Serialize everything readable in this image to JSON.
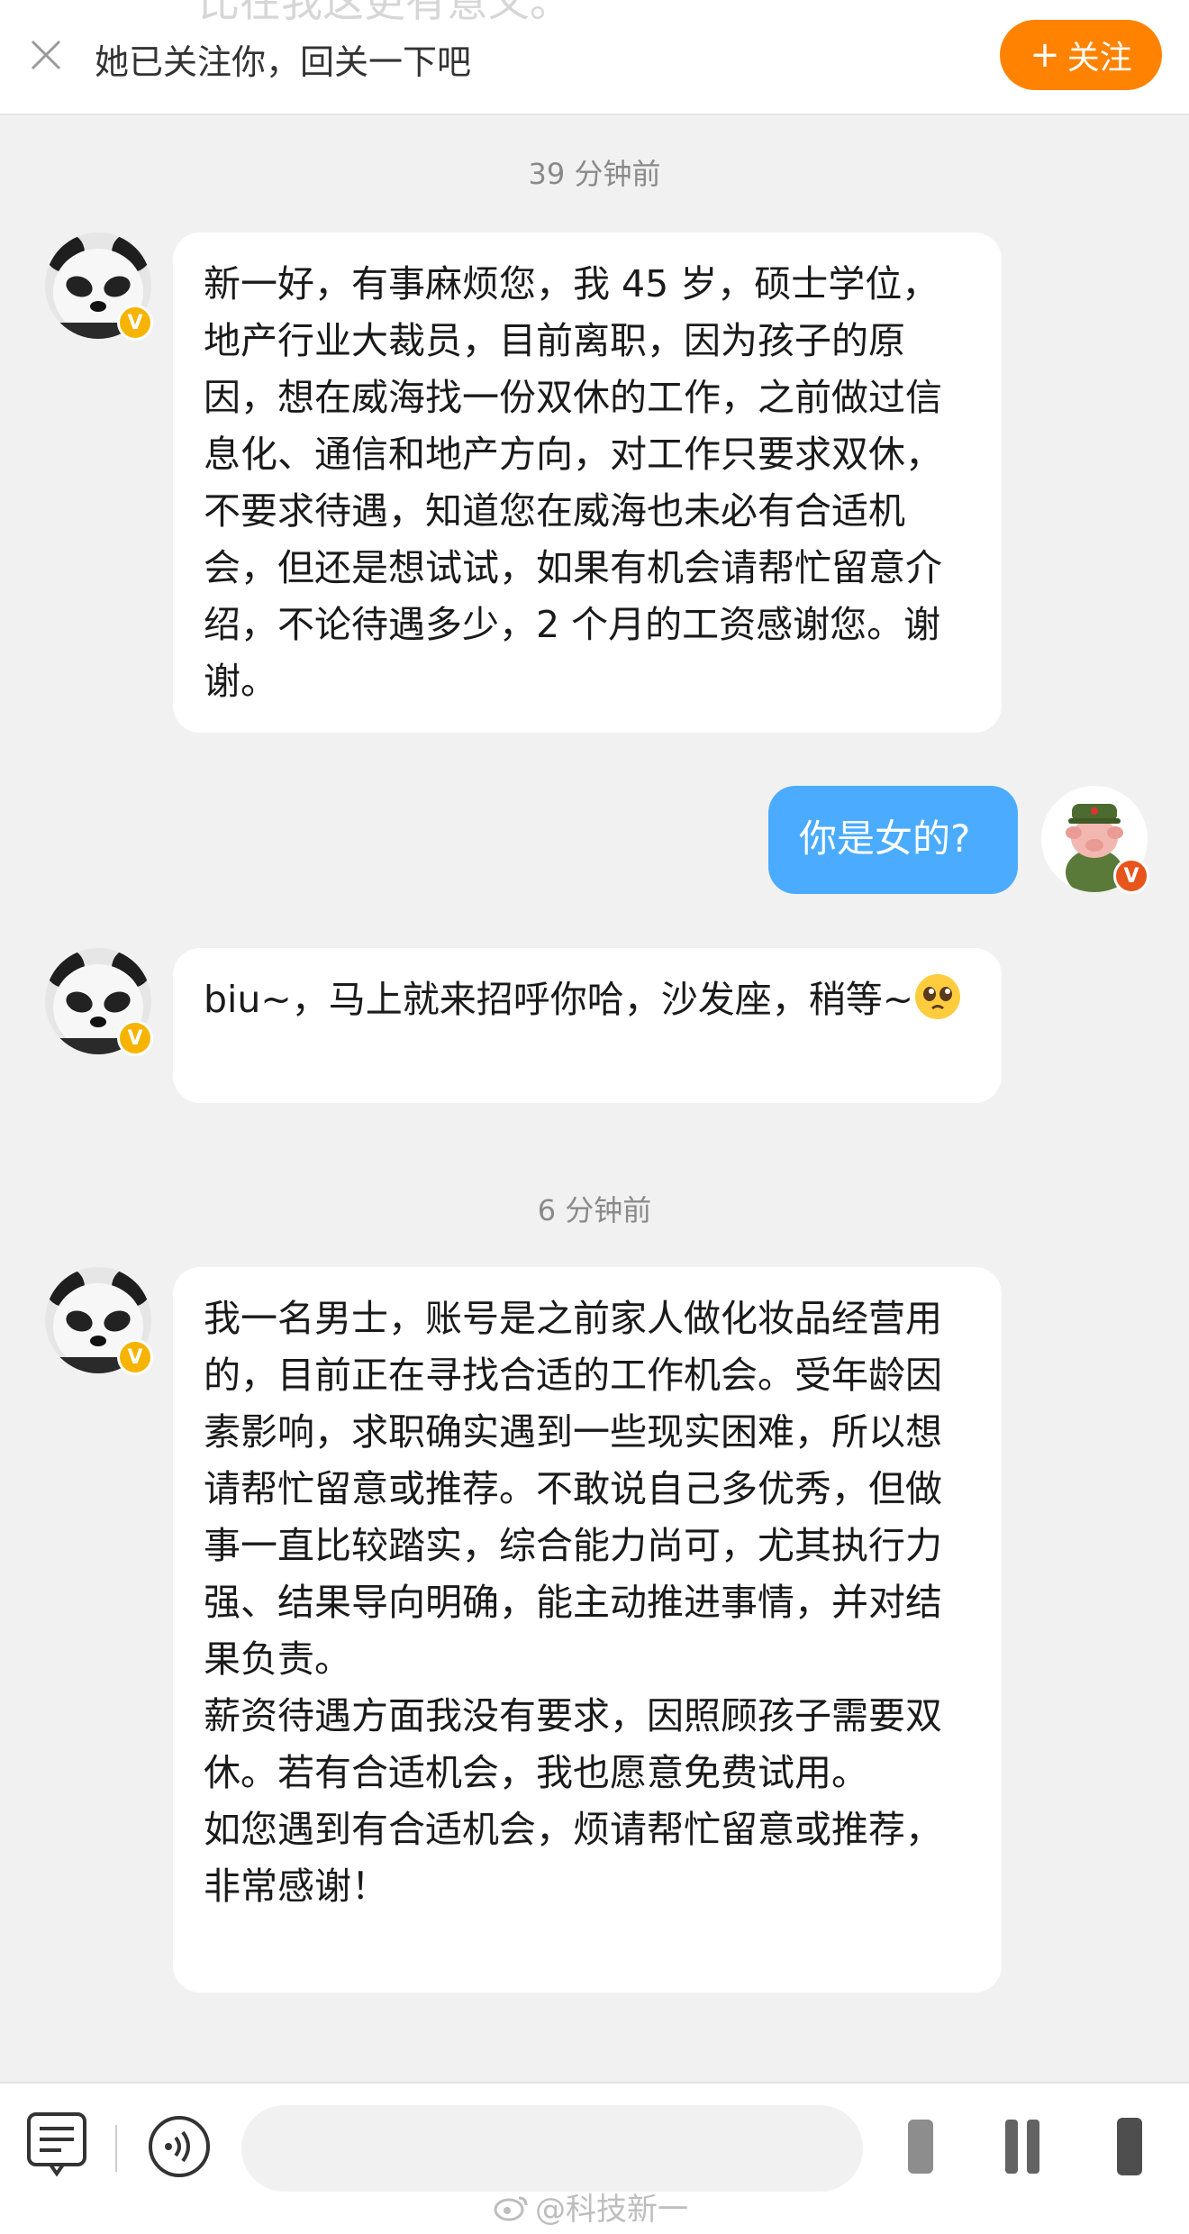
{
  "top_bar": {
    "peek_text": "比在我这更有意义。",
    "follow_hint": "她已关注你，回关一下吧",
    "follow_button": "关注"
  },
  "timestamps": [
    "39 分钟前",
    "6 分钟前"
  ],
  "messages": [
    {
      "sender": "other",
      "text": "新一好，有事麻烦您，我 45 岁，硕士学位，地产行业大裁员，目前离职，因为孩子的原因，想在威海找一份双休的工作，之前做过信息化、通信和地产方向，对工作只要求双休，不要求待遇，知道您在威海也未必有合适机会，但还是想试试，如果有机会请帮忙留意介绍，不论待遇多少，2 个月的工资感谢您。谢谢。"
    },
    {
      "sender": "me",
      "text": "你是女的?"
    },
    {
      "sender": "other",
      "text": "biu~，马上就来招呼你哈，沙发座，稍等~",
      "emoji": "pleading-face-emoji"
    },
    {
      "sender": "other",
      "text": "我一名男士，账号是之前家人做化妆品经营用的，目前正在寻找合适的工作机会。受年龄因素影响，求职确实遇到一些现实困难，所以想请帮忙留意或推荐。不敢说自己多优秀，但做事一直比较踏实，综合能力尚可，尤其执行力强、结果导向明确，能主动推进事情，并对结果负责。\n薪资待遇方面我没有要求，因照顾孩子需要双休。若有合适机会，我也愿意免费试用。\n如您遇到有合适机会，烦请帮忙留意或推荐，非常感谢！"
    }
  ],
  "watermark": "@科技新一",
  "colors": {
    "follow_button": "#ff8200",
    "my_bubble": "#4bacff",
    "verified_badge": "#f6b400",
    "background": "#f1f1f1"
  },
  "icons": [
    "close-icon",
    "plus-icon",
    "verified-badge-icon",
    "message-list-icon",
    "voice-icon",
    "emoji-icon",
    "add-icon"
  ]
}
